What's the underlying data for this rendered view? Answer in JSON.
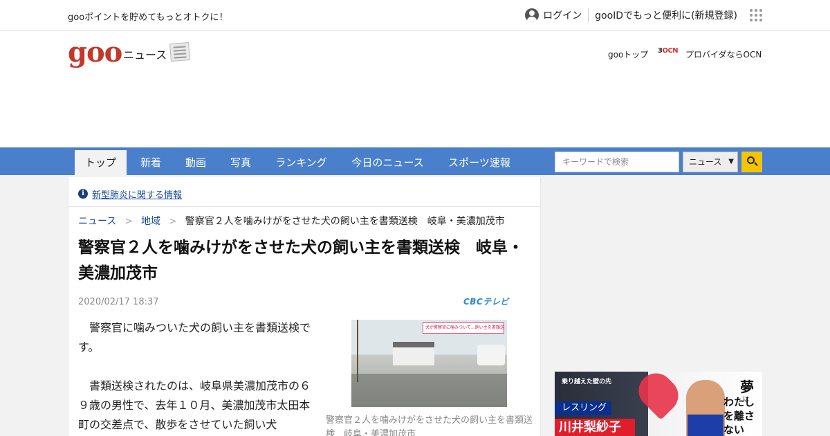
{
  "topbar": {
    "promo": "gooポイントを貯めてもっとオトクに！",
    "login": "ログイン",
    "register": "gooIDでもっと便利に(新規登録)"
  },
  "header": {
    "logo": "goo",
    "section": "ニュース",
    "goo_top": "gooトップ",
    "ocn_logo": "OCN",
    "ocn_text": "プロバイダならOCN"
  },
  "nav": {
    "tabs": [
      {
        "label": "トップ",
        "active": true
      },
      {
        "label": "新着"
      },
      {
        "label": "動画"
      },
      {
        "label": "写真"
      },
      {
        "label": "ランキング"
      },
      {
        "label": "今日のニュース"
      },
      {
        "label": "スポーツ速報"
      }
    ],
    "search_placeholder": "キーワードで検索",
    "search_scope": "ニュース"
  },
  "notice": {
    "link": "新型肺炎に関する情報"
  },
  "breadcrumb": {
    "items": [
      "ニュース",
      "地域"
    ],
    "separator": ">",
    "current": "警察官２人を噛みけがをさせた犬の飼い主を書類送検　岐阜・美濃加茂市"
  },
  "article": {
    "headline": "警察官２人を噛みけがをさせた犬の飼い主を書類送検　岐阜・美濃加茂市",
    "date": "2020/02/17 18:37",
    "source": "CBCテレビ",
    "paragraphs": [
      "警察官に噛みついた犬の飼い主を書類送検です。",
      "書類送検されたのは、岐阜県美濃加茂市の６９歳の男性で、去年１０月、美濃加茂市太田本町の交差点で、散歩をさせていた飼い犬"
    ],
    "photo_telop": "犬が警察官に噛みついて…飼い主を書類送検",
    "caption": "警察官２人を噛みけがをさせた犬の飼い主を書類送検　岐阜・美濃加茂市"
  },
  "ad": {
    "tagline": "乗り越えた壁の先",
    "sport": "レスリング",
    "athlete": "川井梨紗子",
    "dream": "夢",
    "small": "は",
    "phrase": "わたしを離さない"
  },
  "colors": {
    "nav_bg": "#4a7fcb",
    "logo": "#c0392b",
    "link": "#1a4ca0",
    "search_button": "#f5c400"
  }
}
